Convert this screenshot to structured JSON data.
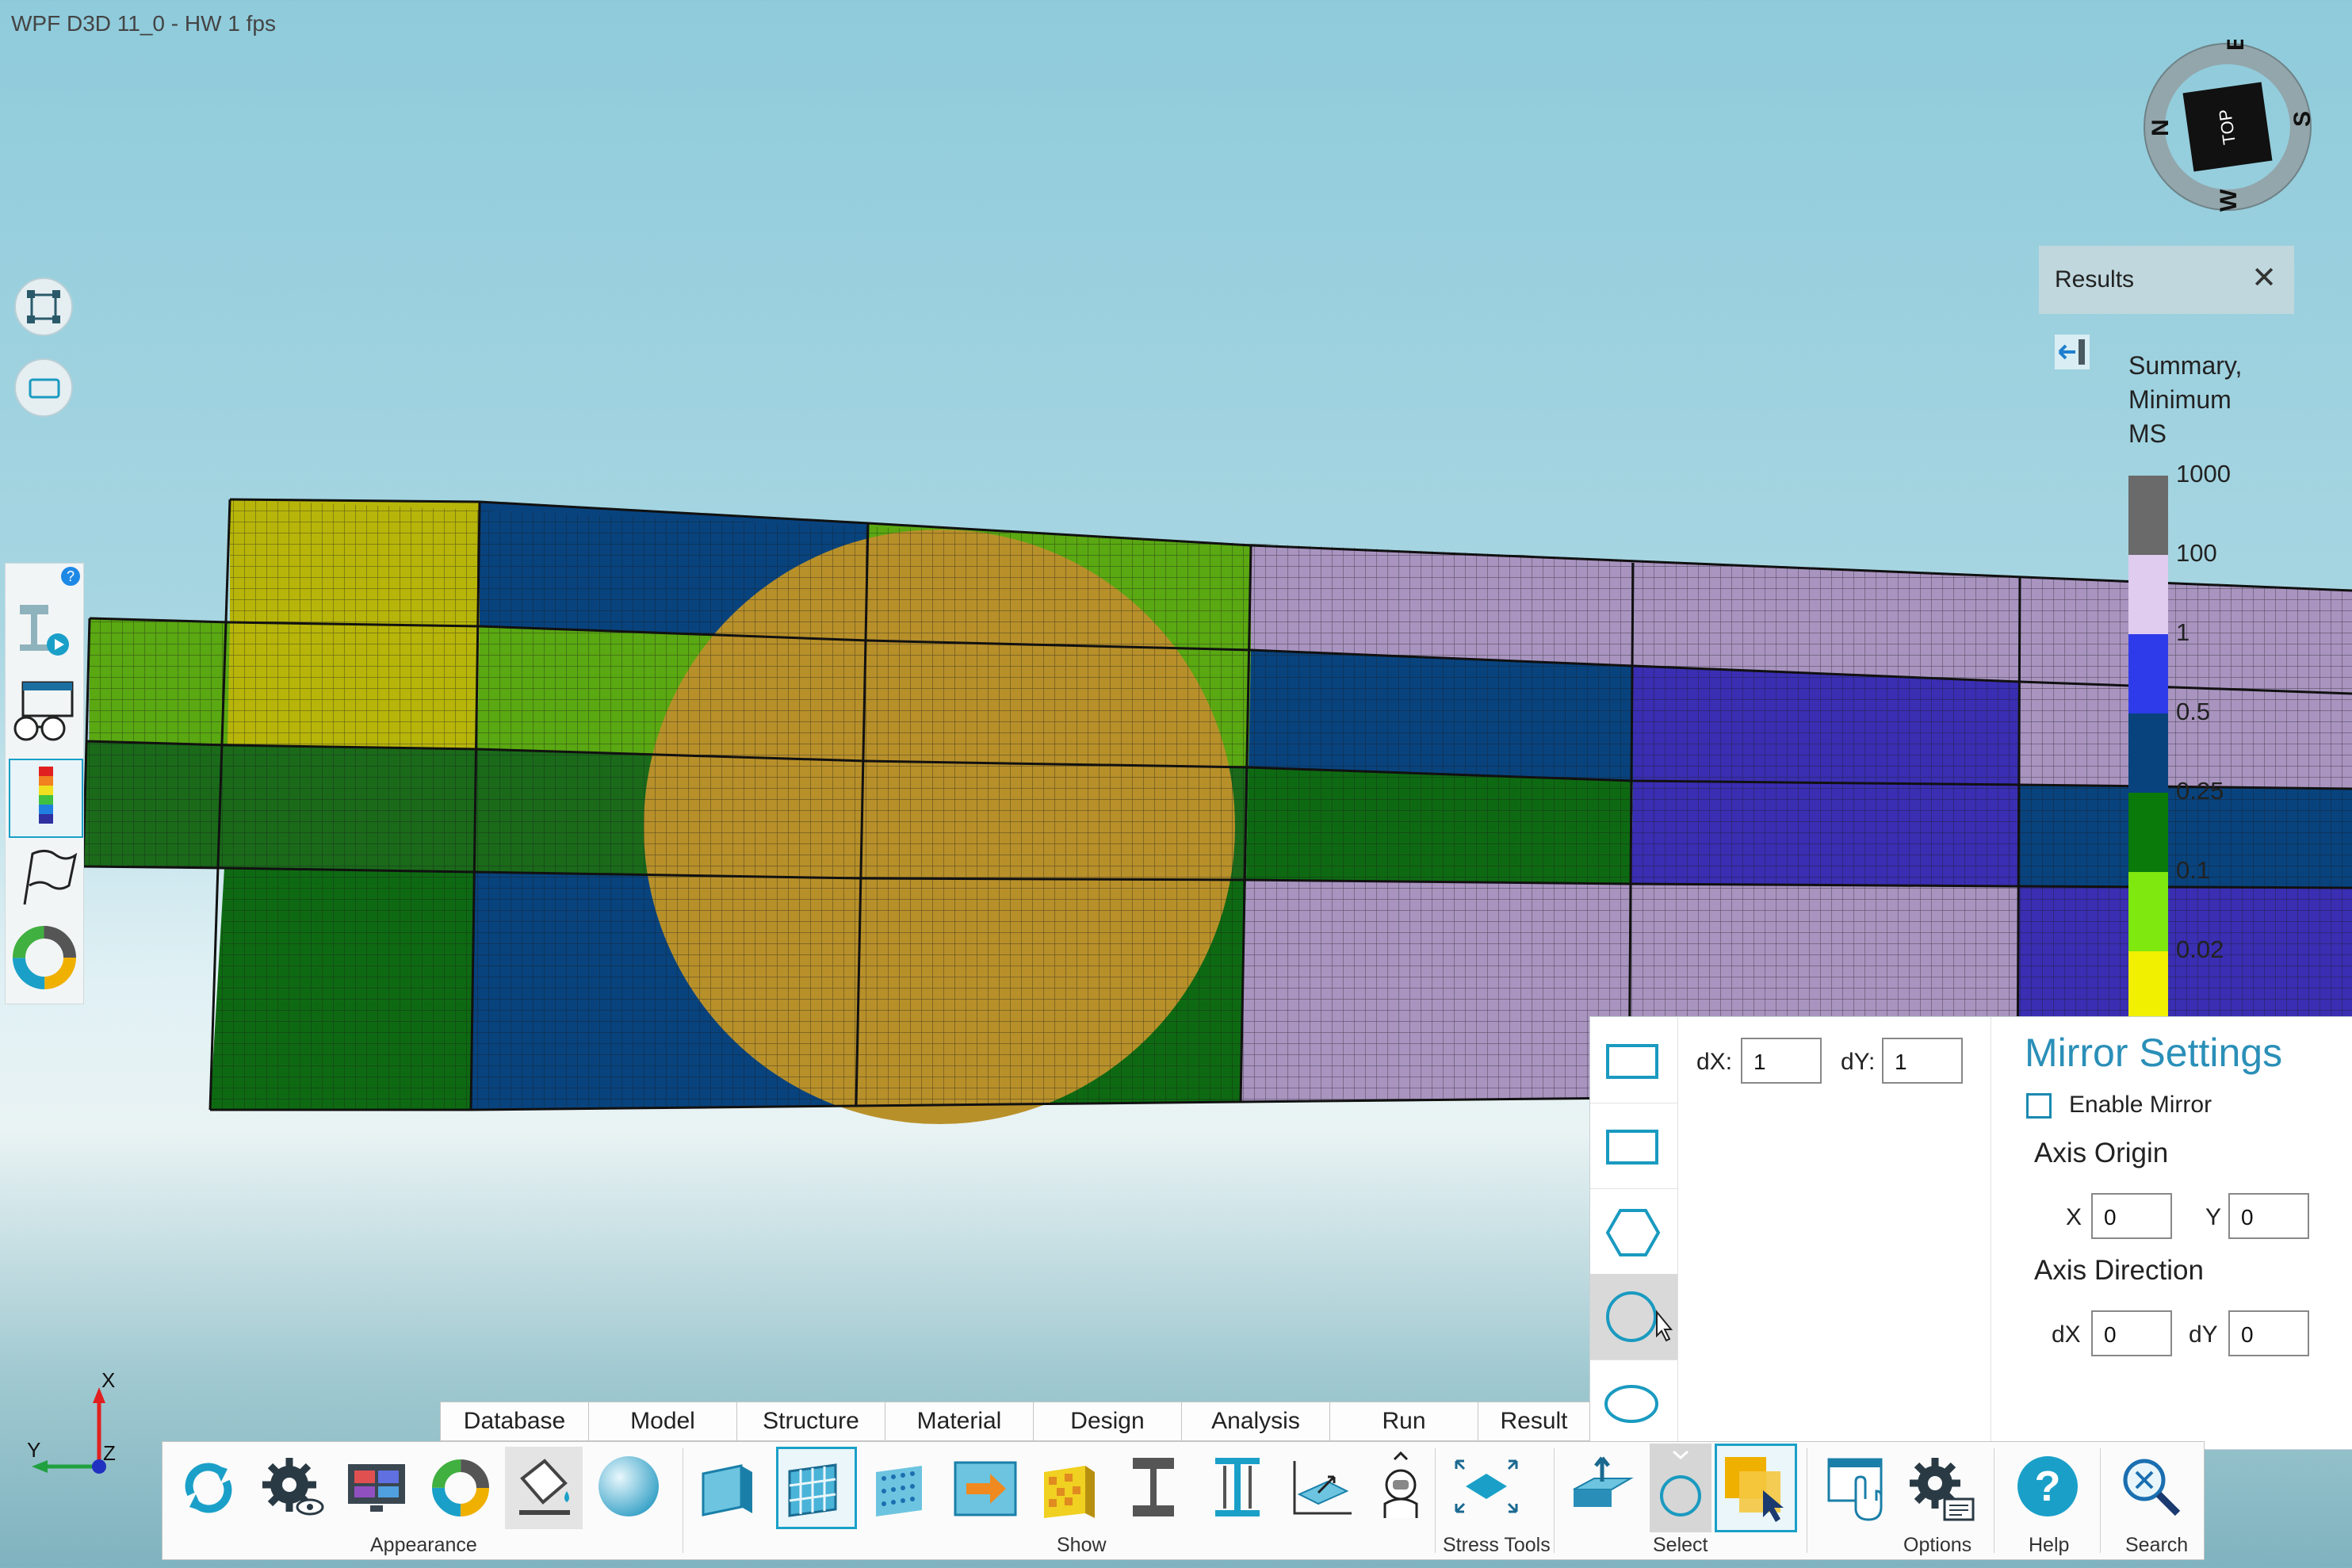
{
  "window": {
    "title": "WPF D3D 11_0 - HW  1 fps"
  },
  "compass": {
    "face_label": "TOP",
    "north": "N",
    "east": "E",
    "south": "S",
    "west": "W"
  },
  "results": {
    "panel_title": "Results",
    "close_glyph": "✕",
    "legend_title_line1": "Summary,",
    "legend_title_line2": "Minimum",
    "legend_title_line3": "MS",
    "legend": [
      {
        "label": "1000",
        "color": "#6a6a6a"
      },
      {
        "label": "100",
        "color": "#e0ccef"
      },
      {
        "label": "1",
        "color": "#2e3bea"
      },
      {
        "label": "0.5",
        "color": "#08437e"
      },
      {
        "label": "0.25",
        "color": "#0a7a0a"
      },
      {
        "label": "0.1",
        "color": "#7fe80e"
      },
      {
        "label": "0.02",
        "color": "#f0f000"
      }
    ]
  },
  "left_toolbar": {
    "help_badge": "?",
    "items": [
      "beam-tool-icon",
      "view-glasses-icon",
      "contour-legend-icon",
      "flag-icon",
      "color-wheel-icon"
    ]
  },
  "mirror_panel": {
    "dx_label": "dX:",
    "dx_value": "1",
    "dy_label": "dY:",
    "dy_value": "1",
    "title": "Mirror Settings",
    "enable_mirror_label": "Enable Mirror",
    "enable_mirror_checked": false,
    "axis_origin_label": "Axis Origin",
    "x_label": "X",
    "x_value": "0",
    "y_label": "Y",
    "y_value": "0",
    "axis_direction_label": "Axis Direction",
    "dir_dx_label": "dX",
    "dir_dx_value": "0",
    "dir_dy_label": "dY",
    "dir_dy_value": "0"
  },
  "tabs": [
    "Database",
    "Model",
    "Structure",
    "Material",
    "Design",
    "Analysis",
    "Run",
    "Result"
  ],
  "ribbon_groups": {
    "appearance": "Appearance",
    "show": "Show",
    "stress_tools": "Stress Tools",
    "select": "Select",
    "options": "Options",
    "help": "Help",
    "search": "Search"
  },
  "axes": {
    "x": "X",
    "y": "Y",
    "z": "Z"
  },
  "mesh_colors": {
    "yellow": "#b7b50a",
    "navy": "#08437e",
    "lime": "#5aa812",
    "green": "#0e6a12",
    "gold": "#b8902a",
    "lavender": "#a994c0",
    "blue": "#3a2eb2",
    "mid_green": "#1a6a1a"
  }
}
